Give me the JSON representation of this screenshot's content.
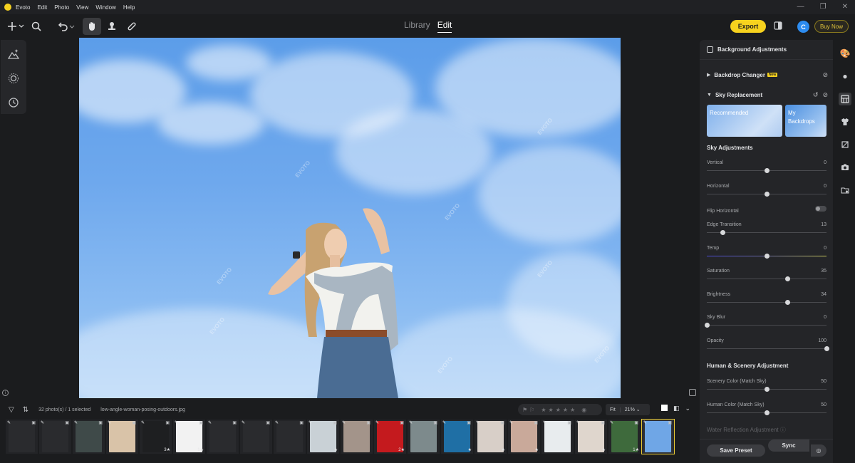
{
  "app": {
    "name": "Evoto",
    "menu": [
      "Edit",
      "Photo",
      "View",
      "Window",
      "Help"
    ],
    "window_controls": [
      "—",
      "❐",
      "✕"
    ]
  },
  "toolbar": {
    "tabs": [
      {
        "label": "Library",
        "active": false
      },
      {
        "label": "Edit",
        "active": true
      }
    ],
    "export_label": "Export",
    "avatar_initial": "C",
    "buy_label": "Buy Now",
    "accent_color": "#f7d21e"
  },
  "right_panel": {
    "header": "Background Adjustments",
    "backdrop_changer": {
      "label": "Backdrop Changer",
      "badge": "New"
    },
    "sky_replacement": {
      "label": "Sky Replacement"
    },
    "cards": [
      {
        "label": "Recommended"
      },
      {
        "label": "My Backdrops"
      }
    ],
    "sky_adjustments_title": "Sky Adjustments",
    "sliders": [
      {
        "name": "Vertical",
        "value": "0",
        "pos": 0.5
      },
      {
        "name": "Horizontal",
        "value": "0",
        "pos": 0.5
      }
    ],
    "flip_label": "Flip Horizontal",
    "sliders2": [
      {
        "name": "Edge Transition",
        "value": "13",
        "pos": 0.13
      },
      {
        "name": "Temp",
        "value": "0",
        "pos": 0.5
      },
      {
        "name": "Saturation",
        "value": "35",
        "pos": 0.675
      },
      {
        "name": "Brightness",
        "value": "34",
        "pos": 0.67
      },
      {
        "name": "Sky Blur",
        "value": "0",
        "pos": 0.0
      },
      {
        "name": "Opacity",
        "value": "100",
        "pos": 1.0
      }
    ],
    "human_title": "Human & Scenery Adjustment",
    "sliders3": [
      {
        "name": "Scenery Color (Match Sky)",
        "value": "50",
        "pos": 0.5
      },
      {
        "name": "Human Color (Match Sky)",
        "value": "50",
        "pos": 0.5
      }
    ],
    "water_reflection": "Water Reflection Adjustment",
    "save_preset": "Save Preset",
    "sync": "Sync"
  },
  "filmstrip": {
    "count": "32 photo(s) / 1 selected",
    "filename": "low-angle-woman-posing-outdoors.jpg",
    "fit": "Fit",
    "zoom": "21%",
    "thumbs": [
      {
        "color": "#2a2b2e",
        "star": ""
      },
      {
        "color": "#2a2b2e",
        "star": ""
      },
      {
        "color": "#3f4a49",
        "star": ""
      },
      {
        "color": "#d9c3a8",
        "star": ""
      },
      {
        "color": "#1e1f21",
        "star": "3★"
      },
      {
        "color": "#f2f2f2",
        "star": "1★"
      },
      {
        "color": "#2a2b2e",
        "star": ""
      },
      {
        "color": "#2a2b2e",
        "star": ""
      },
      {
        "color": "#2a2b2e",
        "star": ""
      },
      {
        "color": "#c9d1d6",
        "star": "★"
      },
      {
        "color": "#a3948a",
        "star": ""
      },
      {
        "color": "#c41a1e",
        "star": "2★"
      },
      {
        "color": "#7d8a8c",
        "star": ""
      },
      {
        "color": "#1f6fa5",
        "star": "★"
      },
      {
        "color": "#d8cfc8",
        "star": "★"
      },
      {
        "color": "#c9a99a",
        "star": "★"
      },
      {
        "color": "#e8ecee",
        "star": ""
      },
      {
        "color": "#dfd6cd",
        "star": "★"
      },
      {
        "color": "#3e6a3c",
        "star": "1★"
      },
      {
        "color": "#6fa6e6",
        "star": "",
        "selected": true
      }
    ]
  }
}
